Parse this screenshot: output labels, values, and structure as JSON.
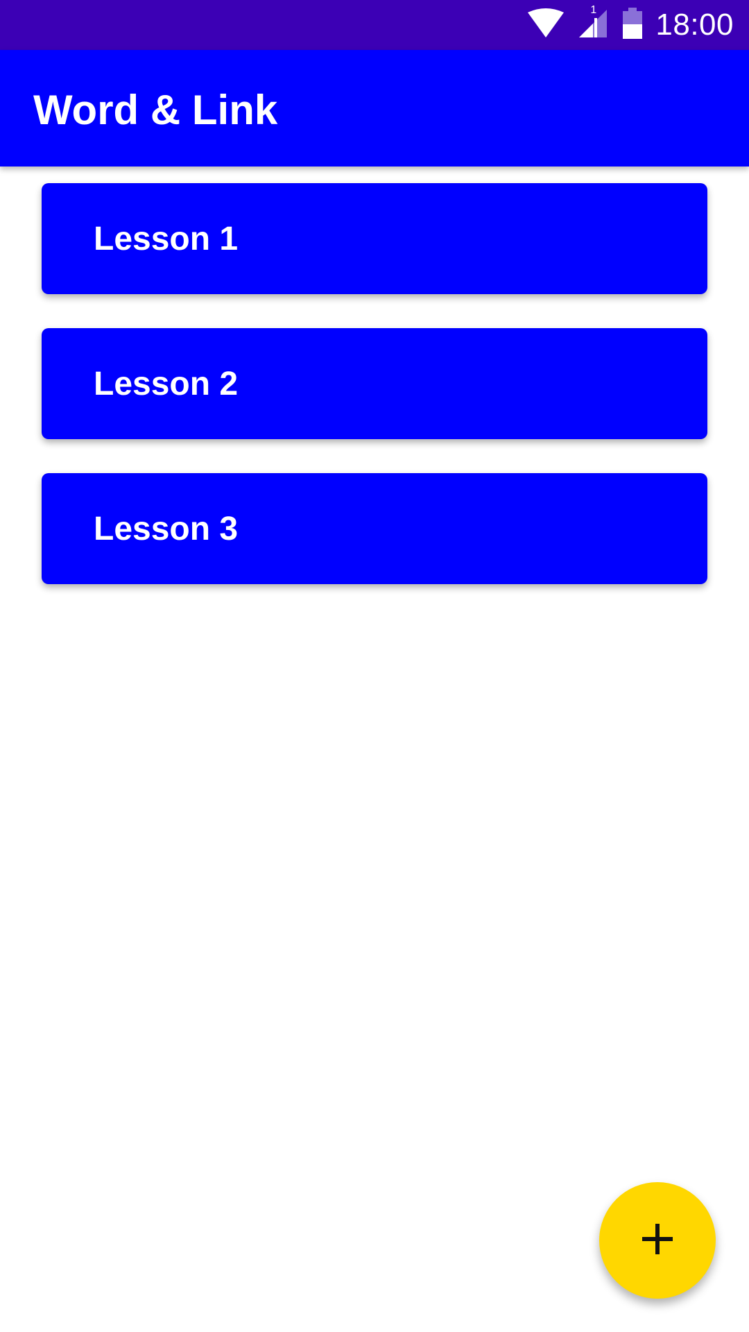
{
  "status_bar": {
    "time": "18:00",
    "sim_slot": "1",
    "icons": [
      "wifi-icon",
      "cell-signal-icon",
      "battery-icon"
    ],
    "background": "#3c00b5"
  },
  "app_bar": {
    "title": "Word & Link",
    "background": "#0000ff"
  },
  "lessons": [
    {
      "label": "Lesson 1"
    },
    {
      "label": "Lesson 2"
    },
    {
      "label": "Lesson 3"
    }
  ],
  "fab": {
    "icon": "plus-icon",
    "color": "#ffd700"
  }
}
